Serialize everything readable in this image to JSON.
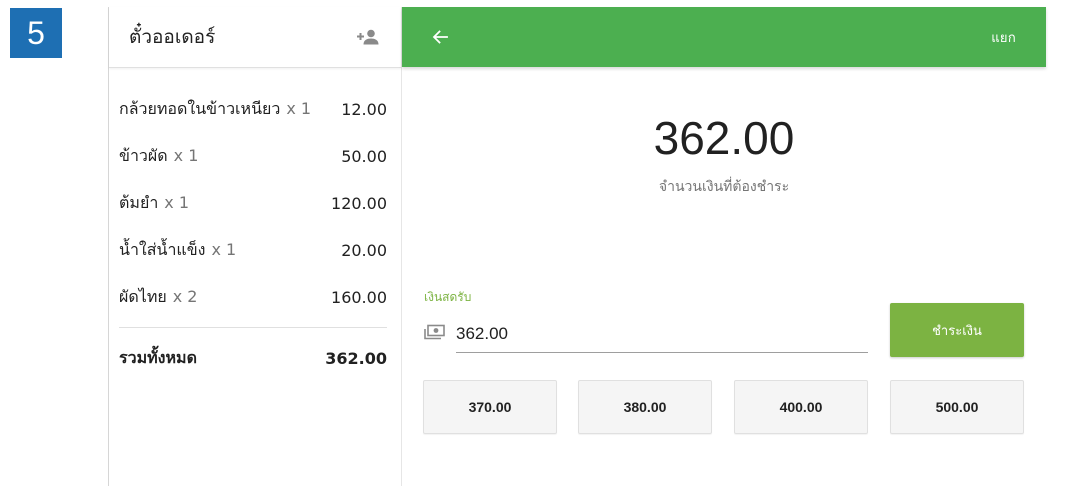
{
  "step_number": "5",
  "ticket": {
    "title": "ตั๋วออเดอร์",
    "items": [
      {
        "name": "กล้วยทอดในข้าวเหนียว",
        "qty": "x 1",
        "price": "12.00"
      },
      {
        "name": "ข้าวผัด",
        "qty": "x 1",
        "price": "50.00"
      },
      {
        "name": "ต้มยำ",
        "qty": "x 1",
        "price": "120.00"
      },
      {
        "name": "น้ำใส่น้ำแข็ง",
        "qty": "x 1",
        "price": "20.00"
      },
      {
        "name": "ผัดไทย",
        "qty": "x 2",
        "price": "160.00"
      }
    ],
    "total_label": "รวมทั้งหมด",
    "total_value": "362.00"
  },
  "appbar": {
    "split_label": "แยก"
  },
  "payment": {
    "amount_due": "362.00",
    "amount_caption": "จำนวนเงินที่ต้องชำระ",
    "cash_label": "เงินสดรับ",
    "cash_value": "362.00",
    "pay_button_label": "ชำระเงิน",
    "quick_amounts": [
      "370.00",
      "380.00",
      "400.00",
      "500.00"
    ]
  },
  "colors": {
    "accent_green": "#4caf50",
    "button_green": "#7cb342",
    "step_badge_blue": "#1e6fb3"
  },
  "icons": {
    "add_customer": "person-add-icon",
    "back": "arrow-back-icon",
    "cash": "cash-icon"
  }
}
